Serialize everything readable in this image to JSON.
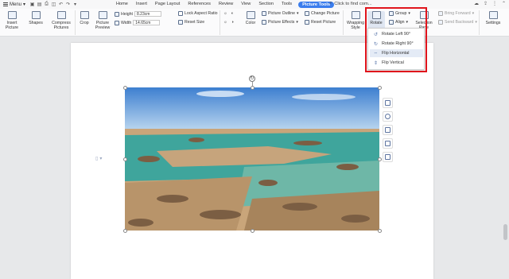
{
  "menubar": {
    "menu_label": "Menu",
    "tabs": [
      "Home",
      "Insert",
      "Page Layout",
      "References",
      "Review",
      "View",
      "Section",
      "Tools",
      "Picture Tools"
    ],
    "active_tab": "Picture Tools",
    "search_placeholder": "Click to find com..."
  },
  "ribbon": {
    "insert_picture": "Insert Picture",
    "shapes": "Shapes",
    "compress": "Compress Pictures",
    "crop": "Crop",
    "picture_preview": "Picture Preview",
    "height_label": "Height",
    "height_value": "8.23cm",
    "width_label": "Width",
    "width_value": "14.65cm",
    "lock_aspect": "Lock Aspect Ratio",
    "reset_size": "Reset Size",
    "color": "Color",
    "picture_outline": "Picture Outline",
    "picture_effects": "Picture Effects",
    "change_picture": "Change Picture",
    "reset_picture": "Reset Picture",
    "wrapping_style": "Wrapping Style",
    "rotate": "Rotate",
    "group": "Group",
    "align": "Align",
    "selection_pane": "Selection Pane",
    "bring_forward": "Bring Forward",
    "send_backward": "Send Backward",
    "settings": "Settings"
  },
  "rotate_menu": {
    "items": [
      {
        "label": "Rotate Left 90°",
        "icon": "rotate-left-icon"
      },
      {
        "label": "Rotate Right 90°",
        "icon": "rotate-right-icon"
      },
      {
        "label": "Flip Horizontal",
        "icon": "flip-horizontal-icon"
      },
      {
        "label": "Flip Vertical",
        "icon": "flip-vertical-icon"
      }
    ],
    "highlighted": "Flip Horizontal"
  },
  "colors": {
    "accent": "#3b7ded",
    "highlight_box": "#e0141c"
  }
}
